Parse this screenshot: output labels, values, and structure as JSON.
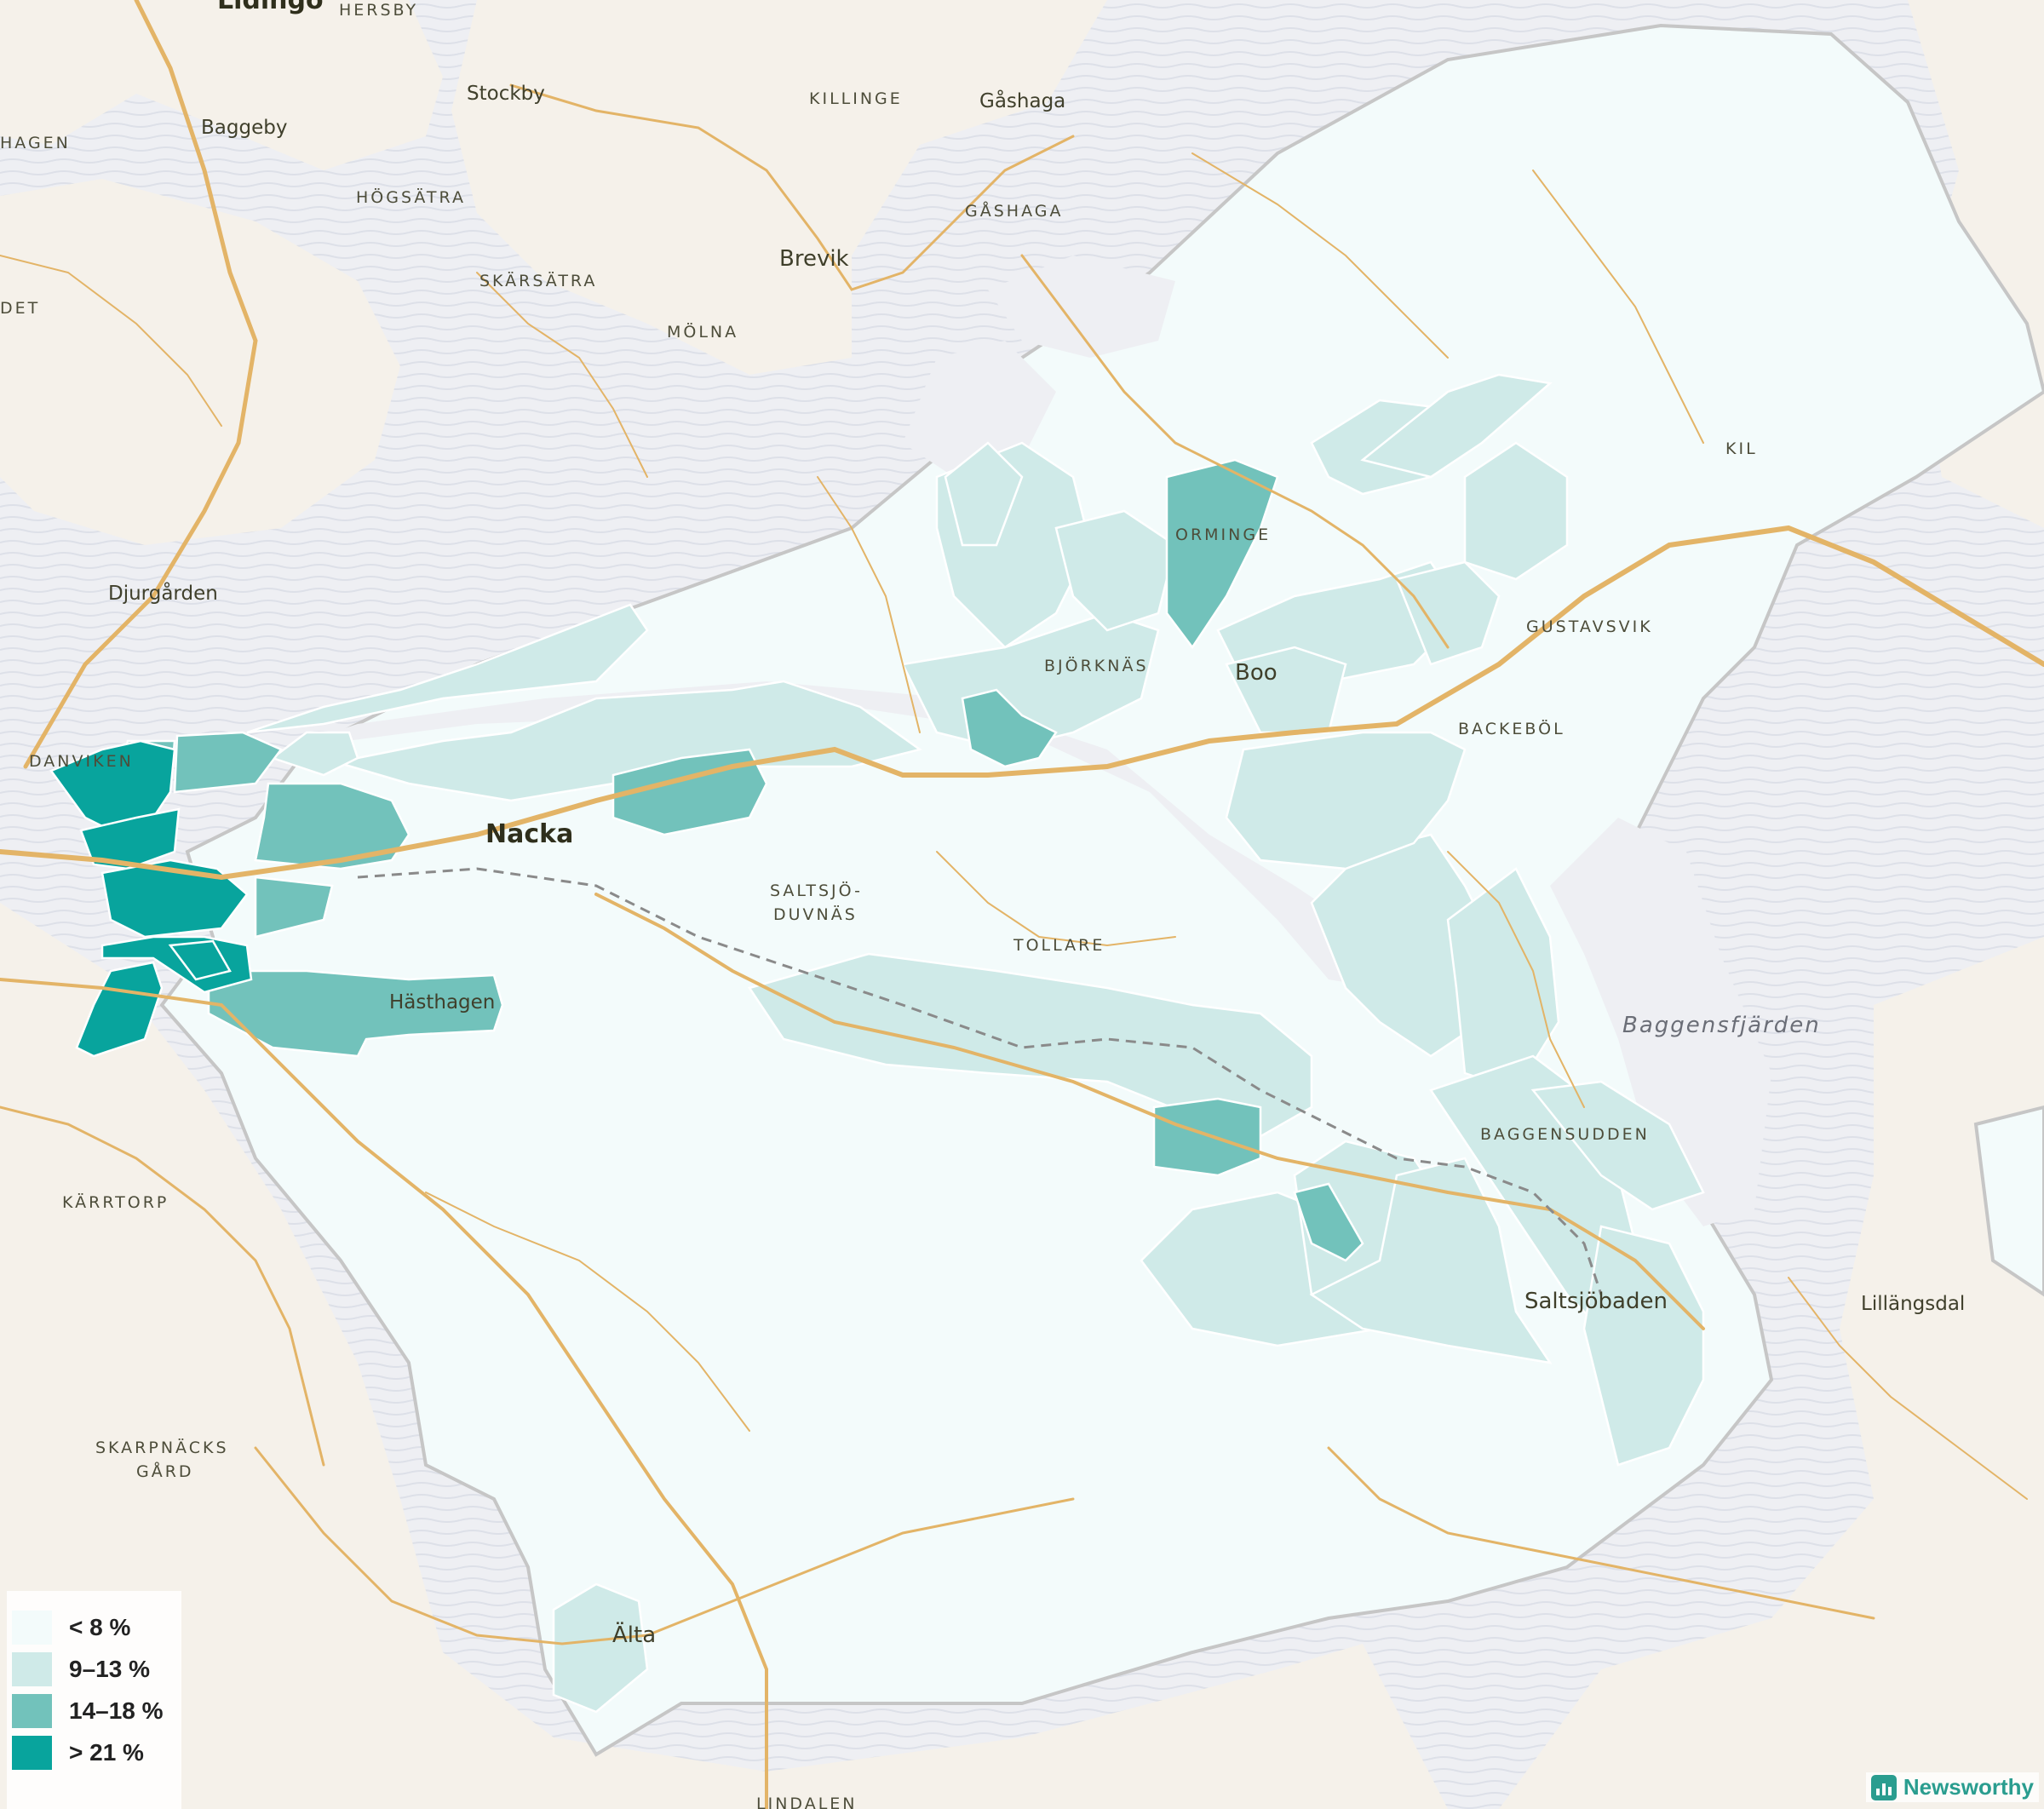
{
  "map": {
    "places": [
      {
        "id": "lidingo",
        "text": "Lidingö"
      },
      {
        "id": "hersby",
        "text": "HERSBY"
      },
      {
        "id": "stockby",
        "text": "Stockby"
      },
      {
        "id": "killinge",
        "text": "KILLINGE"
      },
      {
        "id": "gashaga",
        "text": "Gåshaga"
      },
      {
        "id": "gashaga-caps",
        "text": "GÅSHAGA"
      },
      {
        "id": "hagen",
        "text": "HAGEN"
      },
      {
        "id": "baggeby",
        "text": "Baggeby"
      },
      {
        "id": "hogsatra",
        "text": "HÖGSÄTRA"
      },
      {
        "id": "brevik",
        "text": "Brevik"
      },
      {
        "id": "skarsatra",
        "text": "SKÄRSÄTRA"
      },
      {
        "id": "det",
        "text": "DET"
      },
      {
        "id": "molna",
        "text": "MÖLNA"
      },
      {
        "id": "kil",
        "text": "KIL"
      },
      {
        "id": "djurgarden",
        "text": "Djurgården"
      },
      {
        "id": "orminge",
        "text": "ORMINGE"
      },
      {
        "id": "gustavsvik",
        "text": "GUSTAVSVIK"
      },
      {
        "id": "bjorknas",
        "text": "BJÖRKNÄS"
      },
      {
        "id": "boo",
        "text": "Boo"
      },
      {
        "id": "backebol",
        "text": "BACKEBÖL"
      },
      {
        "id": "danviken",
        "text": "DANVIKEN"
      },
      {
        "id": "nacka",
        "text": "Nacka"
      },
      {
        "id": "saltsjo-duvnas-1",
        "text": "SALTSJÖ-"
      },
      {
        "id": "saltsjo-duvnas-2",
        "text": "DUVNÄS"
      },
      {
        "id": "tollare",
        "text": "TOLLARE"
      },
      {
        "id": "hasthagen",
        "text": "Hästhagen"
      },
      {
        "id": "baggensfjarden",
        "text": "Baggensfjärden"
      },
      {
        "id": "baggensudden",
        "text": "BAGGENSUDDEN"
      },
      {
        "id": "karrtorp",
        "text": "KÄRRTORP"
      },
      {
        "id": "saltsjobaden",
        "text": "Saltsjöbaden"
      },
      {
        "id": "lillangsdal",
        "text": "Lillängsdal"
      },
      {
        "id": "skarpnacks-1",
        "text": "SKARPNÄCKS"
      },
      {
        "id": "skarpnacks-2",
        "text": "GÅRD"
      },
      {
        "id": "alta",
        "text": "Älta"
      },
      {
        "id": "lindalen",
        "text": "LINDALEN"
      }
    ],
    "colors": {
      "water": "#eeeff3",
      "land": "#f5f1ea",
      "road": "#e3b467",
      "boundary": "#c6c6c6",
      "class_lt8": "#f3fbfb",
      "class_9_13": "#cfeae8",
      "class_14_18": "#72c2bb",
      "class_gt21": "#08a49d"
    }
  },
  "legend": {
    "items": [
      {
        "label": "< 8 %",
        "color": "#f3fbfb"
      },
      {
        "label": "9–13 %",
        "color": "#cfeae8"
      },
      {
        "label": "14–18 %",
        "color": "#72c2bb"
      },
      {
        "label": "> 21 %",
        "color": "#08a49d"
      }
    ]
  },
  "brand": {
    "name": "Newsworthy",
    "color": "#2a9d8f",
    "icon": "bar-chart-icon"
  }
}
